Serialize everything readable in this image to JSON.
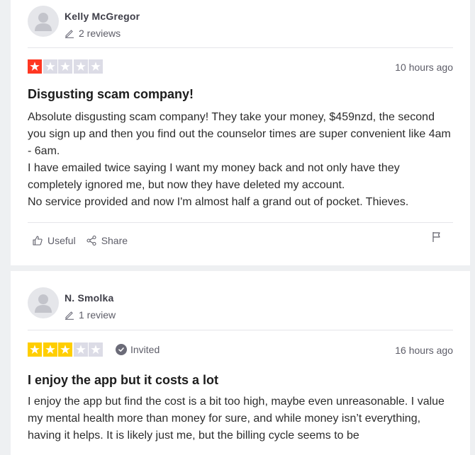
{
  "reviews": [
    {
      "reviewer_name": "Kelly McGregor",
      "review_count": "2 reviews",
      "rating": 1,
      "star_color": "#ff3722",
      "date": "10 hours ago",
      "title": "Disgusting scam company!",
      "body": [
        "Absolute disgusting scam company! They take your money, $459nzd, the second you sign up and then you find out the counselor times are super convenient like 4am - 6am.",
        "I have emailed twice saying I want my money back and not only have they completely ignored me, but now they have deleted my account.",
        "No service provided and now I'm almost half a grand out of pocket. Thieves."
      ],
      "useful_label": "Useful",
      "share_label": "Share"
    },
    {
      "reviewer_name": "N. Smolka",
      "review_count": "1 review",
      "rating": 3,
      "star_color": "#ffce00",
      "invited_label": "Invited",
      "date": "16 hours ago",
      "title": "I enjoy the app but it costs a lot",
      "body": [
        "I enjoy the app but find the cost is a bit too high, maybe even unreasonable. I value my mental health more than money for sure, and while money isn’t everything, having it helps. It is likely just me, but the billing cycle seems to be"
      ]
    }
  ]
}
